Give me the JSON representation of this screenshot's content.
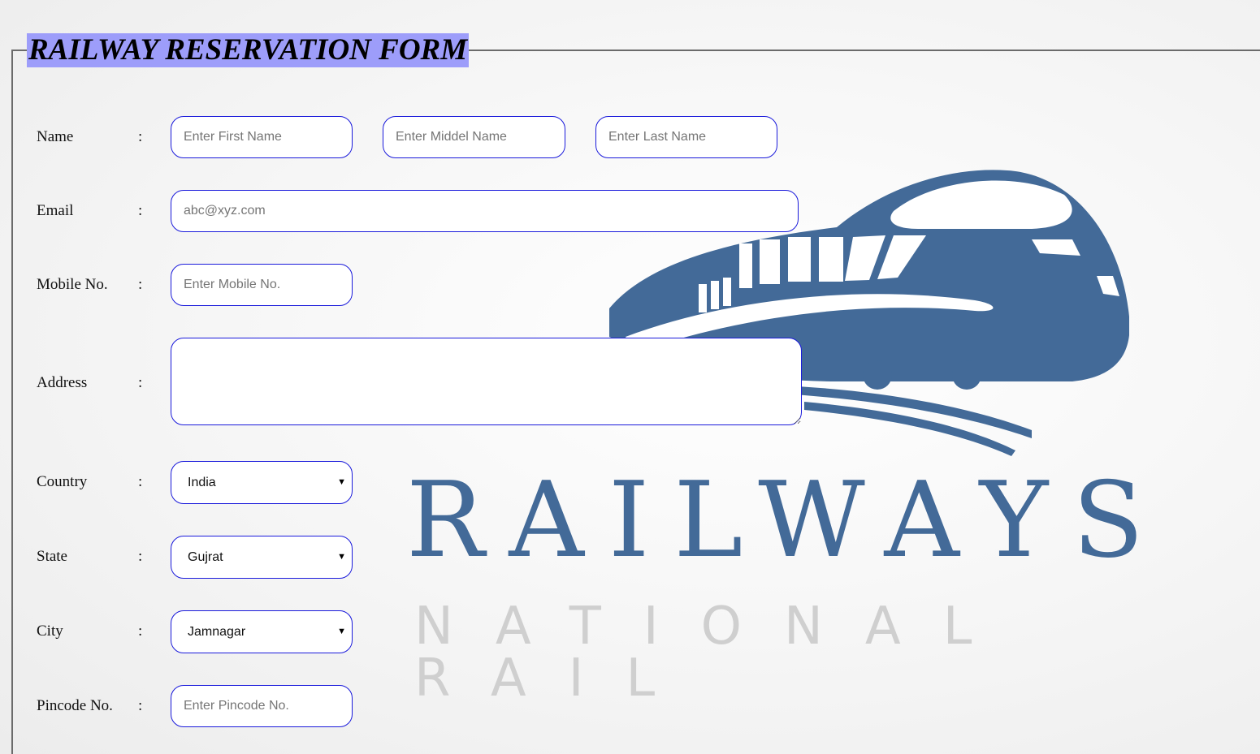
{
  "form": {
    "title": "RAILWAY RESERVATION FORM"
  },
  "logo": {
    "word": "RAILWAYS",
    "sub": "NATIONAL RAIL",
    "colors": {
      "brand": "#436a98",
      "sub": "#cfcfcf"
    }
  },
  "colors": {
    "legend_bg": "#9d9dfa",
    "field_border": "#1a1adb"
  },
  "separator": ":",
  "fields": {
    "name": {
      "label": "Name",
      "first_placeholder": "Enter First Name",
      "middle_placeholder": "Enter Middel Name",
      "last_placeholder": "Enter Last Name"
    },
    "email": {
      "label": "Email",
      "placeholder": "abc@xyz.com"
    },
    "mobile": {
      "label": "Mobile No.",
      "placeholder": "Enter Mobile No."
    },
    "address": {
      "label": "Address",
      "placeholder": ""
    },
    "country": {
      "label": "Country",
      "selected": "India"
    },
    "state": {
      "label": "State",
      "selected": "Gujrat"
    },
    "city": {
      "label": "City",
      "selected": "Jamnagar"
    },
    "pincode": {
      "label": "Pincode No.",
      "placeholder": "Enter Pincode No."
    }
  },
  "icons": {
    "dropdown": "dropdown-caret-icon",
    "logo": "train-logo-icon"
  }
}
